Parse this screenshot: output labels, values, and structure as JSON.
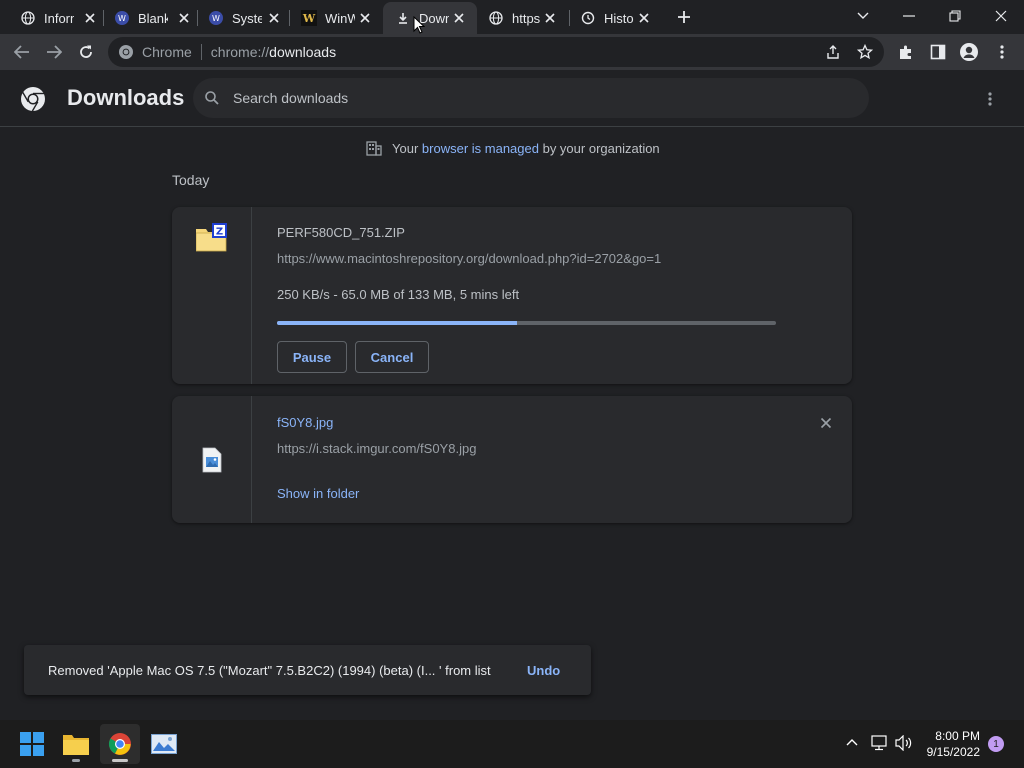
{
  "tabs": [
    {
      "label": "Inform",
      "icon": "globe-icon"
    },
    {
      "label": "Blank",
      "icon": "site-favicon-icon"
    },
    {
      "label": "Syste",
      "icon": "site-favicon-icon"
    },
    {
      "label": "WinW",
      "icon": "winworld-icon"
    },
    {
      "label": "Down",
      "icon": "download-icon",
      "active": true
    },
    {
      "label": "https",
      "icon": "globe-icon"
    },
    {
      "label": "Histo",
      "icon": "history-icon"
    }
  ],
  "omnibox": {
    "site_label": "Chrome",
    "url_scheme": "chrome://",
    "url_host": "downloads"
  },
  "header": {
    "title": "Downloads",
    "search_placeholder": "Search downloads"
  },
  "managed_notice": {
    "prefix": "Your ",
    "link": "browser is managed",
    "suffix": " by your organization"
  },
  "section_label": "Today",
  "downloads": [
    {
      "name": "PERF580CD_751.ZIP",
      "url": "https://www.macintoshrepository.org/download.php?id=2702&go=1",
      "status": "250 KB/s - 65.0 MB of 133 MB, 5 mins left",
      "progress": 0.48,
      "pause_label": "Pause",
      "cancel_label": "Cancel"
    },
    {
      "name": "fS0Y8.jpg",
      "url": "https://i.stack.imgur.com/fS0Y8.jpg",
      "show_in_folder": "Show in folder"
    }
  ],
  "toast": {
    "message": "Removed 'Apple Mac OS 7.5 (\"Mozart\" 7.5.B2C2) (1994) (beta) (I... ' from list",
    "undo_label": "Undo"
  },
  "taskbar": {
    "time": "8:00 PM",
    "date": "9/15/2022",
    "notification_count": "1"
  },
  "colors": {
    "accent": "#8ab4f8",
    "background": "#202124",
    "card": "#292a2d"
  }
}
